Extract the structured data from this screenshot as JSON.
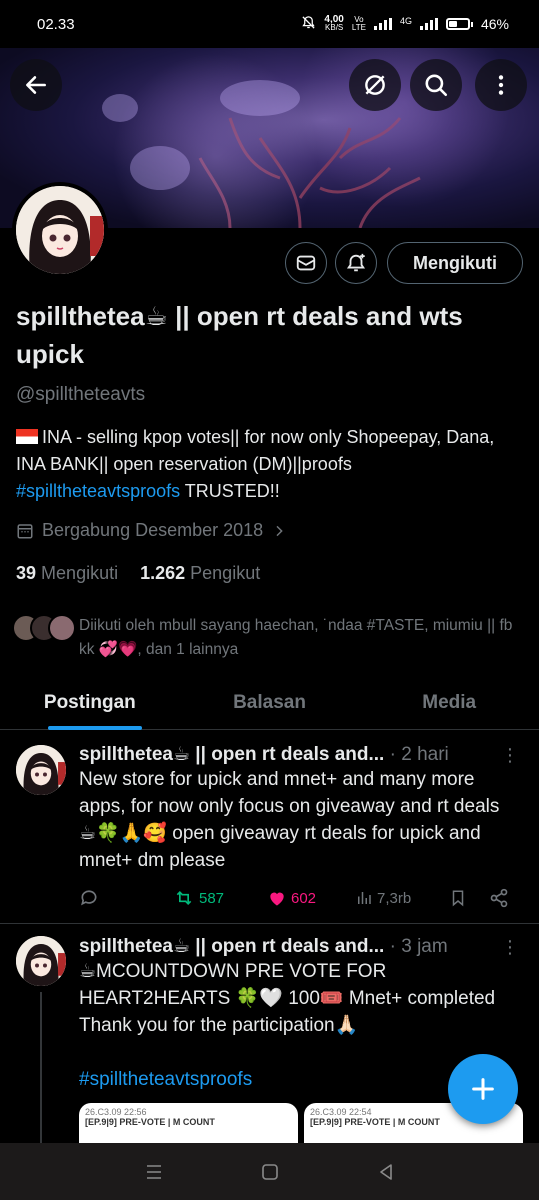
{
  "status_bar": {
    "time": "02.33",
    "speed_value": "4,00",
    "speed_unit": "KB/S",
    "network_top": "Vo",
    "network_bottom": "LTE",
    "network_type": "4G",
    "battery": "46%",
    "battery_level": 0.46
  },
  "header": {
    "back_icon": "arrow-left-icon",
    "grok_icon": "slash-circle-icon",
    "search_icon": "search-icon",
    "more_icon": "more-vertical-icon"
  },
  "profile": {
    "name": "spillthetea☕ || open rt deals and wts upick",
    "handle": "@spilltheteavts",
    "bio_text": "INA - selling kpop votes|| for now only Shopeepay, Dana, INA BANK|| open reservation (DM)||proofs",
    "bio_hashtag": "#spilltheteavtsproofs",
    "bio_end": " TRUSTED!!",
    "joined": "Bergabung Desember 2018",
    "following_count": "39",
    "following_label": "Mengikuti",
    "followers_count": "1.262",
    "followers_label": "Pengikut",
    "followed_by": "Diikuti oleh mbull sayang haechan, ˙ndaa #TASTE, miumiu || fb kk 💞💗, dan 1 lainnya",
    "follow_button": "Mengikuti"
  },
  "tabs": [
    {
      "label": "Postingan",
      "active": true
    },
    {
      "label": "Balasan",
      "active": false
    },
    {
      "label": "Media",
      "active": false
    }
  ],
  "posts": [
    {
      "name": "spillthetea☕ || open rt deals and...",
      "time": "· 2 hari",
      "text": "New store for upick and mnet+ and many more apps, for now only focus on giveaway and rt deals ☕🍀🙏🥰 open giveaway rt deals for upick and mnet+ dm please",
      "reposts": "587",
      "likes": "602",
      "views": "7,3rb"
    },
    {
      "name": "spillthetea☕ || open rt deals and...",
      "time": "· 3 jam",
      "text_line1": "☕MCOUNTDOWN PRE VOTE FOR HEART2HEARTS 🍀🤍 100🎟️ Mnet+ completed",
      "text_line2": "Thank you for the participation🙏🏻",
      "hashtag": "#spilltheteavtsproofs",
      "media": [
        {
          "date": "26.C3.09 22:56",
          "title": "[EP.9|9] PRE-VOTE | M COUNT"
        },
        {
          "date": "26.C3.09 22:54",
          "title": "[EP.9|9] PRE-VOTE | M COUNT"
        }
      ]
    }
  ],
  "colors": {
    "accent": "#1d9bf0",
    "like": "#f91880",
    "repost": "#00ba7c",
    "muted": "#71767b",
    "text": "#e7e9ea"
  }
}
